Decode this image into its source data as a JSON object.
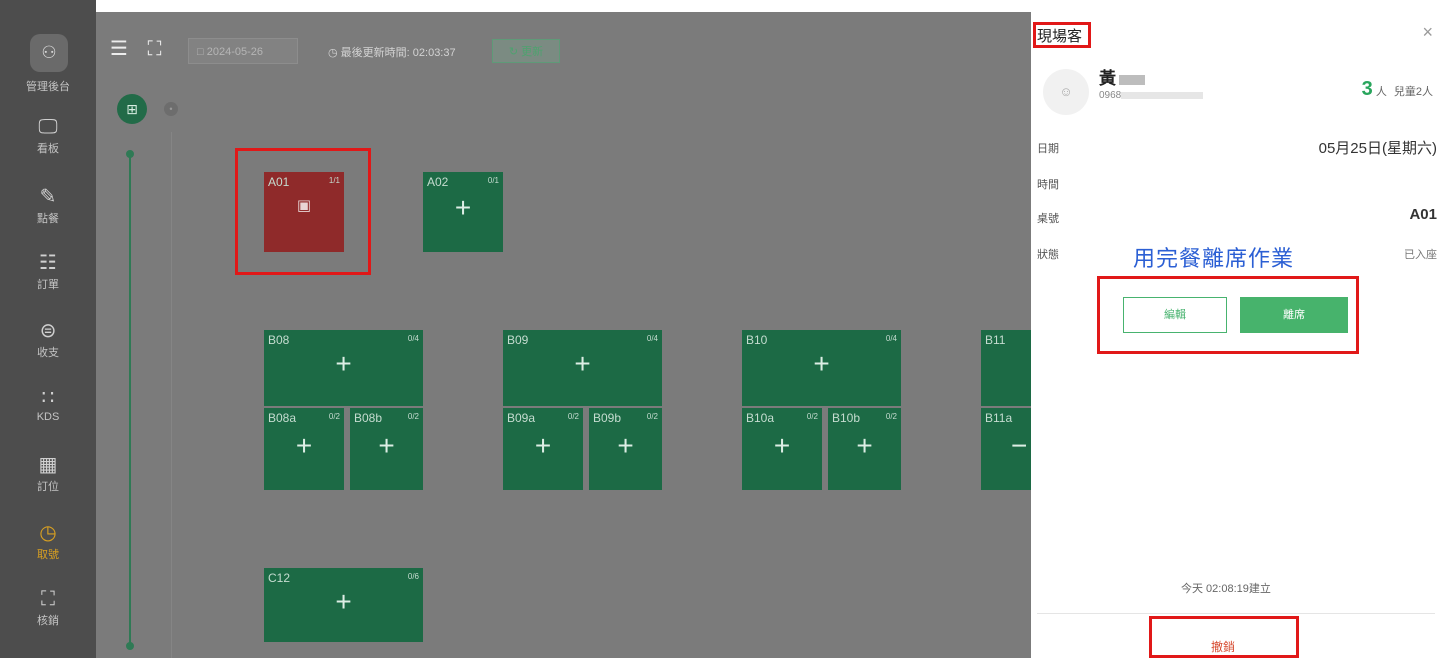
{
  "sidebar": {
    "admin_label": "管理後台",
    "items": [
      {
        "label": "看板",
        "icon": "monitor-icon"
      },
      {
        "label": "點餐",
        "icon": "pencil-icon"
      },
      {
        "label": "訂單",
        "icon": "clipboard-icon"
      },
      {
        "label": "收支",
        "icon": "money-icon"
      },
      {
        "label": "KDS",
        "icon": "grid-dots-icon"
      },
      {
        "label": "訂位",
        "icon": "calendar-icon"
      },
      {
        "label": "取號",
        "icon": "clock-icon"
      },
      {
        "label": "核銷",
        "icon": "scan-icon"
      }
    ],
    "active_item": "取號"
  },
  "toolbar": {
    "date": "2024-05-26",
    "last_refresh": "最後更新時間: 02:03:37",
    "refresh_button": "更新"
  },
  "tables": [
    {
      "code": "A01",
      "capacity": "1/1",
      "status": "occupied"
    },
    {
      "code": "A02",
      "capacity": "0/1",
      "status": "available"
    },
    {
      "code": "B08",
      "capacity": "0/4",
      "status": "available"
    },
    {
      "code": "B08a",
      "capacity": "0/2",
      "status": "available"
    },
    {
      "code": "B08b",
      "capacity": "0/2",
      "status": "available"
    },
    {
      "code": "B09",
      "capacity": "0/4",
      "status": "available"
    },
    {
      "code": "B09a",
      "capacity": "0/2",
      "status": "available"
    },
    {
      "code": "B09b",
      "capacity": "0/2",
      "status": "available"
    },
    {
      "code": "B10",
      "capacity": "0/4",
      "status": "available"
    },
    {
      "code": "B10a",
      "capacity": "0/2",
      "status": "available"
    },
    {
      "code": "B10b",
      "capacity": "0/2",
      "status": "available"
    },
    {
      "code": "B11",
      "capacity": "",
      "status": "available"
    },
    {
      "code": "B11a",
      "capacity": "",
      "status": "available"
    },
    {
      "code": "C12",
      "capacity": "0/6",
      "status": "available"
    }
  ],
  "drawer": {
    "title": "現場客",
    "close": "×",
    "customer_name": "黃",
    "phone": "0968",
    "party_count": "3",
    "party_unit": "人",
    "children": "兒童2人",
    "rows": {
      "date_label": "日期",
      "date_value": "05月25日(星期六)",
      "time_label": "時間",
      "time_value": "",
      "table_label": "桌號",
      "table_value": "A01",
      "status_label": "狀態",
      "status_value": "已入座"
    },
    "annotation": "用完餐離席作業",
    "edit_button": "編輯",
    "leave_button": "離席",
    "created": "今天 02:08:19建立",
    "cancel": "撤銷"
  },
  "colors": {
    "table_available": "#1c6a45",
    "table_occupied": "#8f2a2a",
    "highlight": "#e11818",
    "accent_green": "#47b36c",
    "annotation_blue": "#2b5fd4"
  }
}
